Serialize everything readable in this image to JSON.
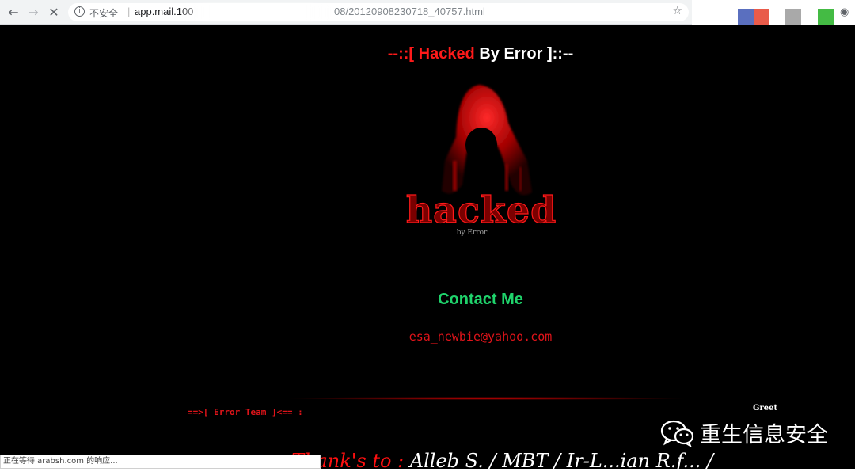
{
  "browser": {
    "back_icon": "←",
    "forward_icon": "→",
    "stop_icon": "✕",
    "info_icon": "i",
    "insecure_label": "不安全",
    "separator": "|",
    "url_host": "app.mail.100",
    "url_path": "08/20120908230718_40757.html",
    "bookmark_icon": "☆",
    "camera_icon": "◉",
    "extension_colors": [
      "#5a6fbf",
      "#e95b4a",
      "#a9a9a9",
      "#44bb44"
    ]
  },
  "page": {
    "title": {
      "prefix": "--::[",
      "hacked": "Hacked",
      "by": "By Error",
      "suffix": "]::--"
    },
    "logo": {
      "word": "hacked",
      "by_line": "by Error"
    },
    "contact_heading": "Contact Me",
    "email": "esa_newbie@yahoo.com",
    "team_line": "==>[ Error Team ]<== :",
    "greet": "Greet",
    "thanks": {
      "prefix": "Thank's to :",
      "names": "Alleb S. / MBT / Ir-L...ian R.f... /"
    }
  },
  "watermark": {
    "text": "重生信息安全"
  },
  "status_bar": {
    "text": "正在等待 arabsh.com 的响应..."
  }
}
